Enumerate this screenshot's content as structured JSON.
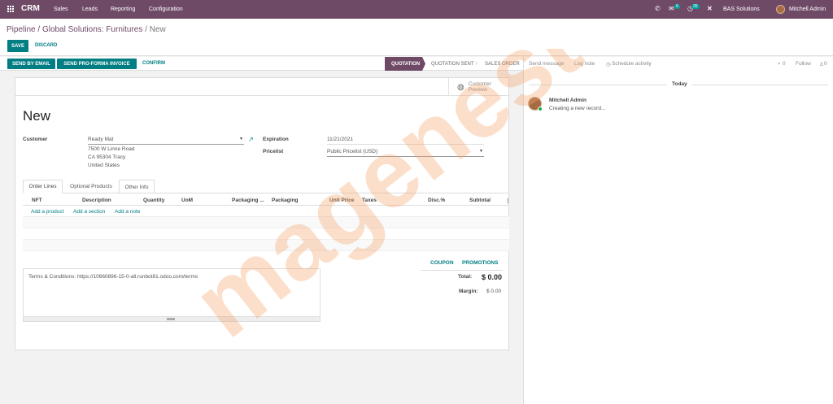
{
  "topbar": {
    "brand": "CRM",
    "menu": [
      "Sales",
      "Leads",
      "Reporting",
      "Configuration"
    ],
    "messages_count": "6",
    "activities_count": "35",
    "company": "BAS Solutions",
    "user": "Mitchell Admin"
  },
  "breadcrumb": {
    "pipeline": "Pipeline",
    "opportunity": "Global Solutions: Furnitures",
    "current": "New",
    "separator": "/"
  },
  "actions": {
    "save": "SAVE",
    "discard": "DISCARD"
  },
  "statusbar": {
    "send_email": "SEND BY EMAIL",
    "send_proforma": "SEND PRO-FORMA INVOICE",
    "confirm": "CONFIRM",
    "stages": [
      "QUOTATION",
      "QUOTATION SENT",
      "SALES ORDER"
    ]
  },
  "form": {
    "preview_line1": "Customer",
    "preview_line2": "Preview",
    "title": "New",
    "customer_label": "Customer",
    "customer_value": "Ready Mat",
    "address_lines": [
      "7500 W Linne Road",
      "CA 95304 Tracy",
      "United States"
    ],
    "expiration_label": "Expiration",
    "expiration_value": "11/21/2021",
    "pricelist_label": "Pricelist",
    "pricelist_value": "Public Pricelist (USD)"
  },
  "tabs": [
    "Order Lines",
    "Optional Products",
    "Other Info"
  ],
  "table": {
    "columns": [
      "NFT",
      "Description",
      "Quantity",
      "UoM",
      "Packaging ...",
      "Packaging",
      "Unit Price",
      "Taxes",
      "Disc.%",
      "Subtotal"
    ],
    "add_links": [
      "Add a product",
      "Add a section",
      "Add a note"
    ]
  },
  "coupon": "COUPON",
  "promotions": "PROMOTIONS",
  "terms": "Terms & Conditions: https://10660896-15-0-all.runbot81.odoo.com/terms",
  "totals": {
    "total_label": "Total:",
    "total_value": "$ 0.00",
    "margin_label": "Margin:",
    "margin_value": "$ 0.00"
  },
  "chatter": {
    "send_message": "Send message",
    "log_note": "Log note",
    "schedule_activity": "Schedule activity",
    "attachments_count": "0",
    "follow": "Follow",
    "followers_count": "0",
    "today": "Today",
    "author": "Mitchell Admin",
    "message": "Creating a new record..."
  },
  "watermark": "magenest",
  "colors": {
    "brand": "#6f4a67",
    "primary": "#017e84",
    "watermark_orange": "#f4a46a",
    "watermark_blue": "#7b8fe0"
  }
}
